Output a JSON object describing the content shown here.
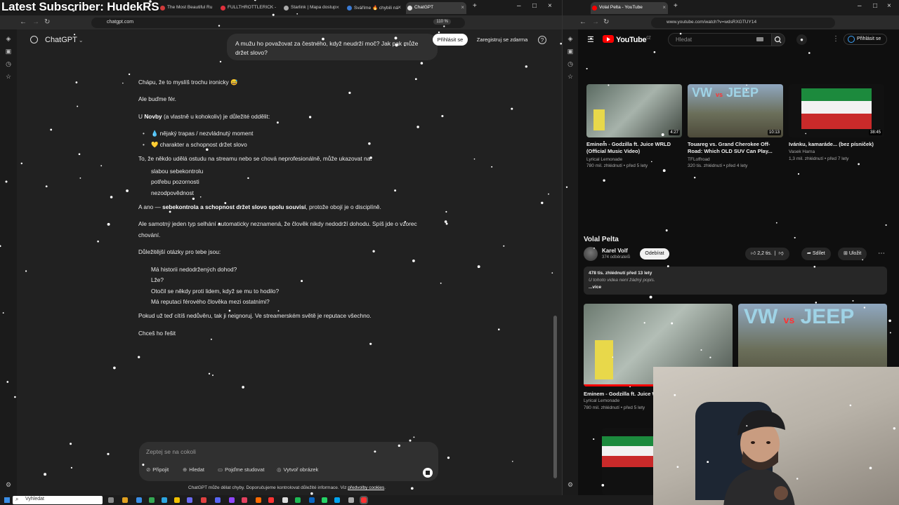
{
  "overlay": {
    "stream_title": "Latest Subscriber: HudekRS"
  },
  "left_browser": {
    "tabs": [
      {
        "label": "The Most Beautiful Ru",
        "color": "#d03a3a"
      },
      {
        "label": "FULLTHROTTLERICK - ",
        "color": "#e0303c"
      },
      {
        "label": "Starlink | Mapa dostup",
        "color": "#aaaaaa"
      },
      {
        "label": "Sváříme 🔥 chybili ná",
        "color": "#3a7bd5"
      },
      {
        "label": "ChatGPT",
        "color": "#dddddd"
      }
    ],
    "url": "chatgpt.com",
    "zoom": "110 %"
  },
  "chatgpt": {
    "model_label": "ChatGPT",
    "login_label": "Přihlásit se",
    "register_label": "Zaregistruj se zdarma",
    "help_icon": "?",
    "user_message": "A mužu ho považovat za čestného, když neudrží moč? Jak pak může držet slovo?",
    "assistant": {
      "p1": "Chápu, že to myslíš trochu ironicky 😅",
      "p2": "Ale buďme fér.",
      "p3_pre": "U ",
      "p3_bold": "Novby",
      "p3_post": " (a vlastně u kohokoliv) je důležité oddělit:",
      "bullets_a": [
        "💧 nějaký trapas / nezvládnutý moment",
        "💛 charakter a schopnost držet slovo"
      ],
      "p4": "To, že někdo udělá ostudu na streamu nebo se chová neprofesionálně, může ukazovat na:",
      "bullets_b": [
        "slabou sebekontrolu",
        "potřebu pozornosti",
        "nezodpovědnost"
      ],
      "p5_pre": "A ano — ",
      "p5_bold": "sebekontrola a schopnost držet slovo spolu souvisí",
      "p5_post": ", protože obojí je o disciplíně.",
      "p6_line1": "Ale samotný jeden typ selhání automaticky neznamená, že člověk nikdy nedodrží dohodu. Spíš jde o vzorec",
      "p6_line2": "chování.",
      "p7": "Důležitější otázky pro tebe jsou:",
      "bullets_c": [
        "Má historii nedodržených dohod?",
        "Lže?",
        "Otočil se někdy proti lidem, když se mu to hodilo?",
        "Má reputaci férového člověka mezi ostatními?"
      ],
      "p8": "Pokud už teď cítíš nedůvěru, tak ji neignoruj. Ve streamerském světě je reputace všechno.",
      "p9": "Chceš ho řešit"
    },
    "composer": {
      "placeholder": "Zeptej se na cokoli",
      "attach": "Připojit",
      "search": "Hledat",
      "study": "Pojďme studovat",
      "image": "Vytvoř obrázek"
    },
    "disclaimer_pre": "ChatGPT může dělat chyby. Doporučujeme kontrolovat důležité informace. Viz ",
    "disclaimer_link": "předvolby cookies",
    "disclaimer_post": "."
  },
  "right_browser": {
    "tab_label": "Volal Pelta - YouTube",
    "url": "www.youtube.com/watch?v=wdsRXGTUY14",
    "youtube": {
      "logo": "YouTube",
      "logo_region": "CZ",
      "search_placeholder": "Hledat",
      "login_label": "Přihlásit se",
      "top_videos": [
        {
          "title": "Eminem - Godzilla ft. Juice WRLD (Official Music Video)",
          "channel": "Lyrical Lemonade",
          "meta": "780 mil. zhlédnutí • před 5 lety",
          "duration": "4:27"
        },
        {
          "title": "Touareg vs. Grand Cherokee Off-Road: Which OLD SUV Can Play...",
          "channel": "TFLoffroad",
          "meta": "320 tis. zhlédnutí • před 4 lety",
          "duration": "10:13"
        },
        {
          "title": "Ivánku, kamaráde... (bez písniček)",
          "channel": "Vasek Harna",
          "meta": "1,3 mil. zhlédnutí • před 7 lety",
          "duration": "38:45"
        }
      ],
      "video_title": "Volal Pelta",
      "channel_name": "Karel Volf",
      "channel_subs": "374 odběratelů",
      "subscribe": "Odebírat",
      "likes": "2,2 tis.",
      "share": "Sdílet",
      "save": "Uložit",
      "views_date": "478 tis. zhlédnutí  před 13 lety",
      "no_desc": "U tohoto videa není žádný popis.",
      "more": "...více",
      "rec": {
        "title": "Eminem - Godzilla ft. Juice WRLD",
        "channel": "Lyrical Lemonade",
        "meta": "780 mil. zhlédnutí • před 5 lety"
      }
    }
  },
  "taskbar": {
    "search_placeholder": "Vyhledat"
  },
  "colors": {
    "yt_red": "#ff0000",
    "link_blue": "#3ea6ff",
    "chat_bg": "#212121"
  }
}
